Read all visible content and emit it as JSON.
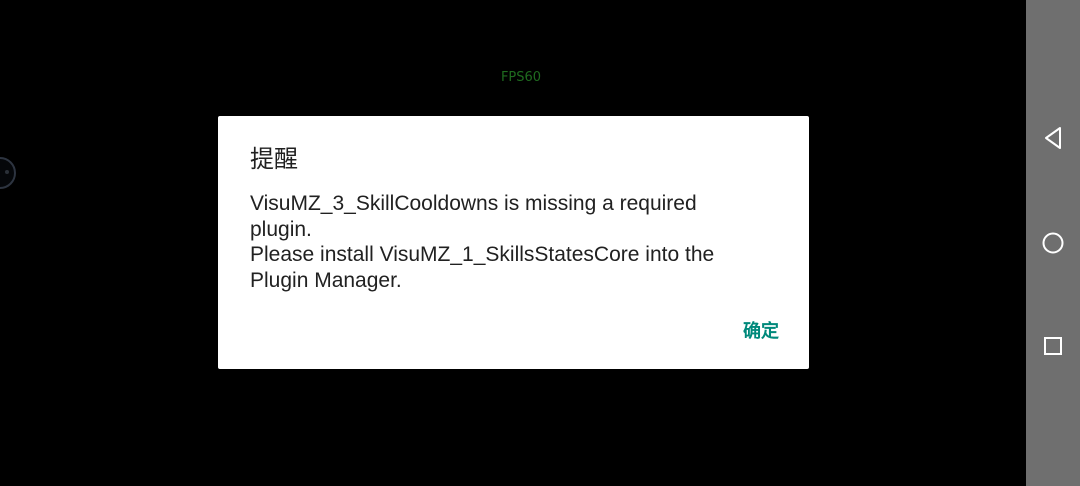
{
  "game": {
    "fps_label": "FPS60"
  },
  "dialog": {
    "title": "提醒",
    "message_lines": [
      "VisuMZ_3_SkillCooldowns is missing a required",
      "plugin.",
      "Please install VisuMZ_1_SkillsStatesCore into the",
      "Plugin Manager."
    ],
    "ok_label": "确定",
    "accent_color": "#00897B"
  },
  "nav_bar": {
    "background_color": "#6F6F6F",
    "buttons": [
      {
        "icon": "back-triangle-icon"
      },
      {
        "icon": "home-circle-icon"
      },
      {
        "icon": "recents-square-icon"
      }
    ]
  }
}
